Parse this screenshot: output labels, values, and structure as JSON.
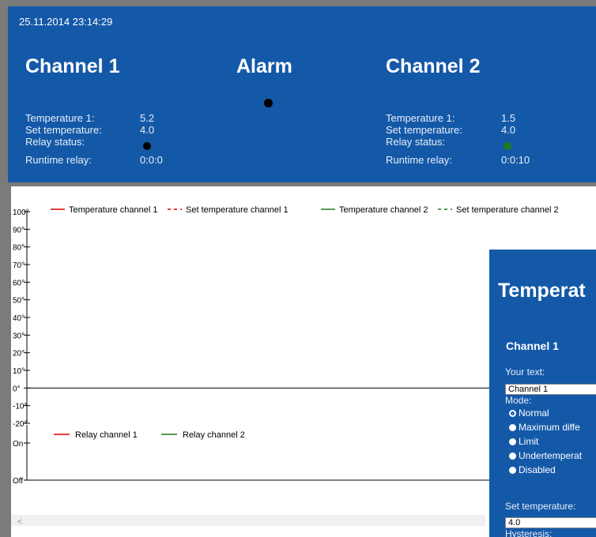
{
  "header": {
    "datetime": "25.11.2014 23:14:29",
    "channel1_title": "Channel 1",
    "alarm_title": "Alarm",
    "channel2_title": "Channel 2"
  },
  "channel1": {
    "temp_label": "Temperature 1:",
    "temp_value": "5.2",
    "set_label": "Set temperature:",
    "set_value": "4.0",
    "relay_label": "Relay status:",
    "relay_color": "#000000",
    "runtime_label": "Runtime relay:",
    "runtime_value": "0:0:0"
  },
  "channel2": {
    "temp_label": "Temperature 1:",
    "temp_value": "1.5",
    "set_label": "Set temperature:",
    "set_value": "4.0",
    "relay_label": "Relay status:",
    "relay_color": "#1f7a1f",
    "runtime_label": "Runtime relay:",
    "runtime_value": "0:0:10"
  },
  "chart_data": {
    "type": "line",
    "series": [
      {
        "name": "Temperature channel 1",
        "color": "#e00000",
        "dash": false,
        "values": []
      },
      {
        "name": "Set temperature channel 1",
        "color": "#e00000",
        "dash": true,
        "values": []
      },
      {
        "name": "Temperature channel 2",
        "color": "#1f7a1f",
        "dash": false,
        "values": []
      },
      {
        "name": "Set temperature channel 2",
        "color": "#1f7a1f",
        "dash": true,
        "values": []
      }
    ],
    "ylim": [
      -20,
      100
    ],
    "y_ticks": [
      "100°",
      "90°",
      "80°",
      "70°",
      "60°",
      "50°",
      "40°",
      "30°",
      "20°",
      "10°",
      "0°",
      "-10°",
      "-20°"
    ],
    "y_tick_values": [
      100,
      90,
      80,
      70,
      60,
      50,
      40,
      30,
      20,
      10,
      0,
      -10,
      -20
    ],
    "relay_series": [
      {
        "name": "Relay channel 1",
        "color": "#e00000"
      },
      {
        "name": "Relay channel 2",
        "color": "#1f7a1f"
      }
    ],
    "relay_ticks": [
      "On",
      "Off"
    ],
    "legend_placement": "top"
  },
  "scroll": {
    "left_arrow": "<"
  },
  "panel": {
    "title": "Temperat",
    "channel": "Channel 1",
    "text_label": "Your text:",
    "text_value": "Channel 1",
    "mode_label": "Mode:",
    "modes": [
      {
        "label": "Normal",
        "selected": true
      },
      {
        "label": "Maximum diffe",
        "selected": false
      },
      {
        "label": "Limit",
        "selected": false
      },
      {
        "label": "Undertemperat",
        "selected": false
      },
      {
        "label": "Disabled",
        "selected": false
      }
    ],
    "set_label": "Set temperature:",
    "set_value": "4.0",
    "hysteresis_label": "Hysteresis:"
  }
}
